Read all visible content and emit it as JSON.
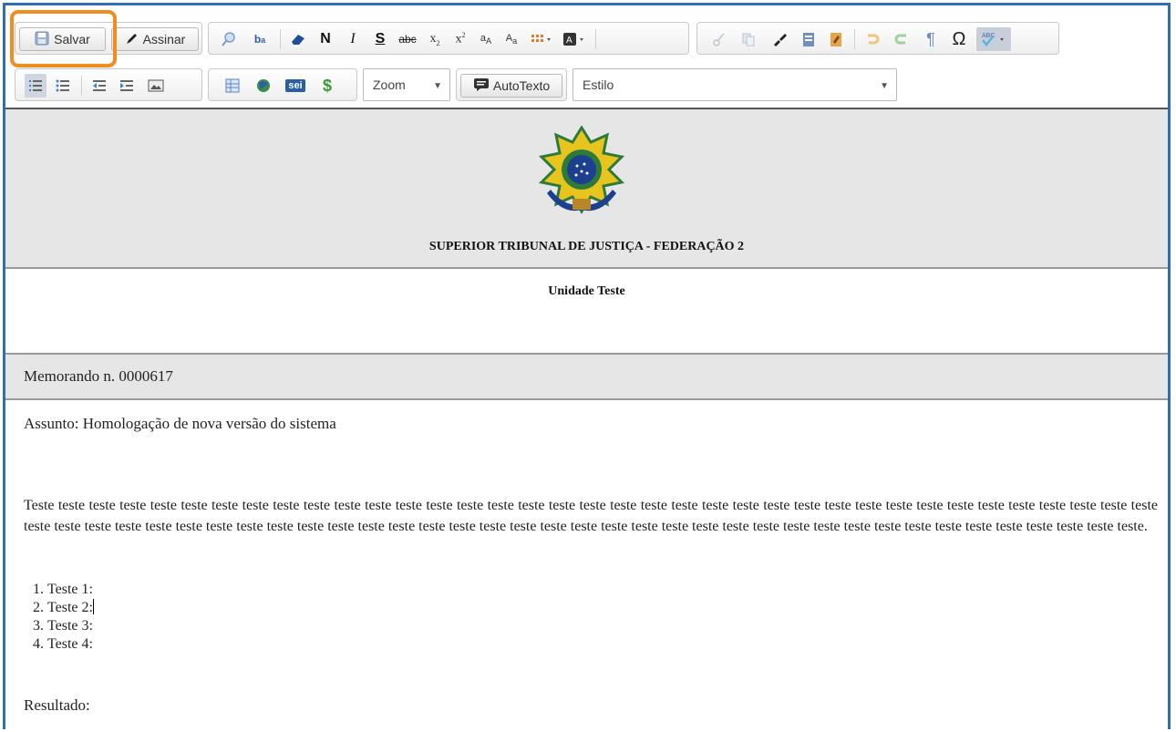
{
  "toolbar": {
    "save_label": "Salvar",
    "sign_label": "Assinar",
    "bold_label": "N",
    "italic_label": "I",
    "underline_label": "S",
    "zoom_label": "Zoom",
    "autotext_label": "AutoTexto",
    "style_label": "Estilo",
    "sei_label": "sei",
    "currency_label": "$",
    "special_char_label": "Ω",
    "highlight_color": "#f28c1e"
  },
  "document": {
    "organization": "SUPERIOR TRIBUNAL DE JUSTIÇA - FEDERAÇÃO 2",
    "unit": "Unidade Teste",
    "memo_number": "Memorando n. 0000617",
    "subject": "Assunto: Homologação de nova versão do sistema",
    "paragraph": "Teste teste teste teste teste teste teste teste teste teste teste teste teste teste teste teste teste teste teste teste teste teste teste teste teste teste teste teste teste teste teste teste teste teste teste teste teste teste teste teste teste teste teste teste teste teste teste teste teste teste teste teste teste teste teste teste teste teste teste teste teste teste teste teste teste teste teste teste teste teste teste teste teste teste.",
    "list_items": [
      "Teste 1:",
      "Teste 2:",
      "Teste 3:",
      "Teste 4:"
    ],
    "result_label": "Resultado:"
  }
}
